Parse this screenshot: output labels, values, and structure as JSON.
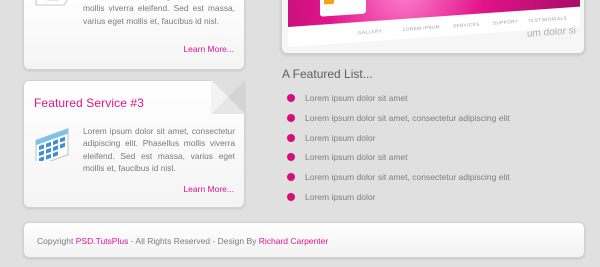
{
  "service_card_top": {
    "text": "consectetur adipiscing elit. Phasellus mollis viverra eleifend. Sed est massa, varius eget mollis et, faucibus id nisl.",
    "learn_more": "Learn More...",
    "icon": "document-icon"
  },
  "service_card_3": {
    "title": "Featured Service #3",
    "text": "Lorem ipsum dolor sit amet, consectetur adipiscing elit. Phasellus mollis viverra eleifend. Sed est massa, varius eget mollis et, faucibus id nisl.",
    "learn_more": "Learn More...",
    "icon": "calendar-icon"
  },
  "preview": {
    "nav": [
      "GALLERY",
      "LOREM IPSUM",
      "SERVICES",
      "SUPPORT",
      "TESTIMONIALS"
    ],
    "tagline": "um dolor si"
  },
  "featured_list": {
    "title": "A Featured List...",
    "items": [
      "Lorem ipsum dolor sit amet",
      "Lorem ipsum dolor sit amet, consectetur adipiscing elit",
      "Lorem ipsum dolor",
      "Lorem ipsum dolor sit amet",
      "Lorem ipsum dolor sit amet, consectetur adipiscing elit",
      "Lorem ipsum dolor"
    ]
  },
  "footer": {
    "prefix": "Copyright ",
    "site_link": "PSD.TutsPlus",
    "middle": " - All Rights Reserved - Design By ",
    "author_link": "Richard Carpenter"
  },
  "colors": {
    "accent": "#e0148a",
    "background": "#e0e0e0",
    "text": "#7a7a7a"
  }
}
